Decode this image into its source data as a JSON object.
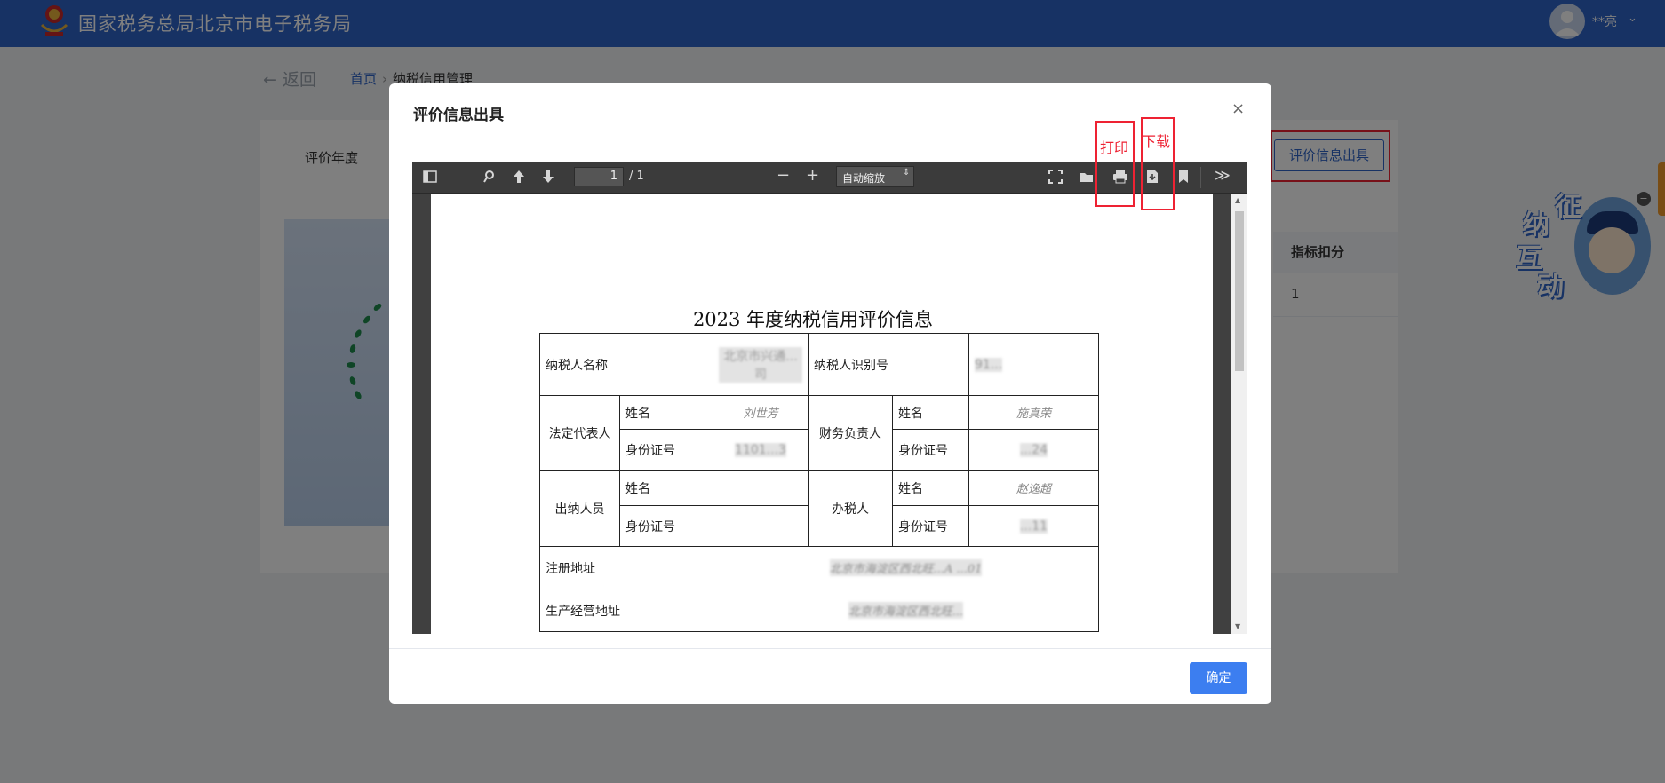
{
  "header": {
    "site_title": "国家税务总局北京市电子税务局",
    "user_name": "**亮",
    "chevron": "⌄"
  },
  "nav": {
    "back_label": "返回",
    "breadcrumb": [
      "首页",
      "纳税信用管理"
    ],
    "separator": "›"
  },
  "content": {
    "year_label": "评价年度",
    "eval_button": "评价信息出具",
    "table_header": "指标扣分",
    "table_value": "1"
  },
  "mascot": {
    "chars": [
      "征",
      "纳",
      "互",
      "动"
    ]
  },
  "modal": {
    "title": "评价信息出具",
    "close": "×",
    "ok_button": "确定",
    "annotations": {
      "print": "打印",
      "download": "下载"
    }
  },
  "viewer": {
    "page_current": "1",
    "page_total": "/ 1",
    "zoom": "自动缩放",
    "zoom_caret": "⇕",
    "more": "≫"
  },
  "document": {
    "title": "2023 年度纳税信用评价信息",
    "taxpayer_name_label": "纳税人名称",
    "taxpayer_name_value": "北京市兴通...司",
    "taxpayer_id_label": "纳税人识别号",
    "taxpayer_id_value": "91...",
    "legal_rep_label": "法定代表人",
    "finance_label": "财务负责人",
    "cashier_label": "出纳人员",
    "tax_agent_label": "办税人",
    "name_label": "姓名",
    "id_label": "身份证号",
    "legal_rep_name": "刘世芳",
    "legal_rep_id": "1101...3",
    "finance_name": "施真荣",
    "finance_id": "...24",
    "tax_agent_name": "赵逸超",
    "tax_agent_id": "...11",
    "reg_address_label": "注册地址",
    "reg_address_value": "北京市海淀区西北旺...A ...01",
    "biz_address_label": "生产经营地址",
    "biz_address_value": "北京市海淀区西北旺..."
  }
}
